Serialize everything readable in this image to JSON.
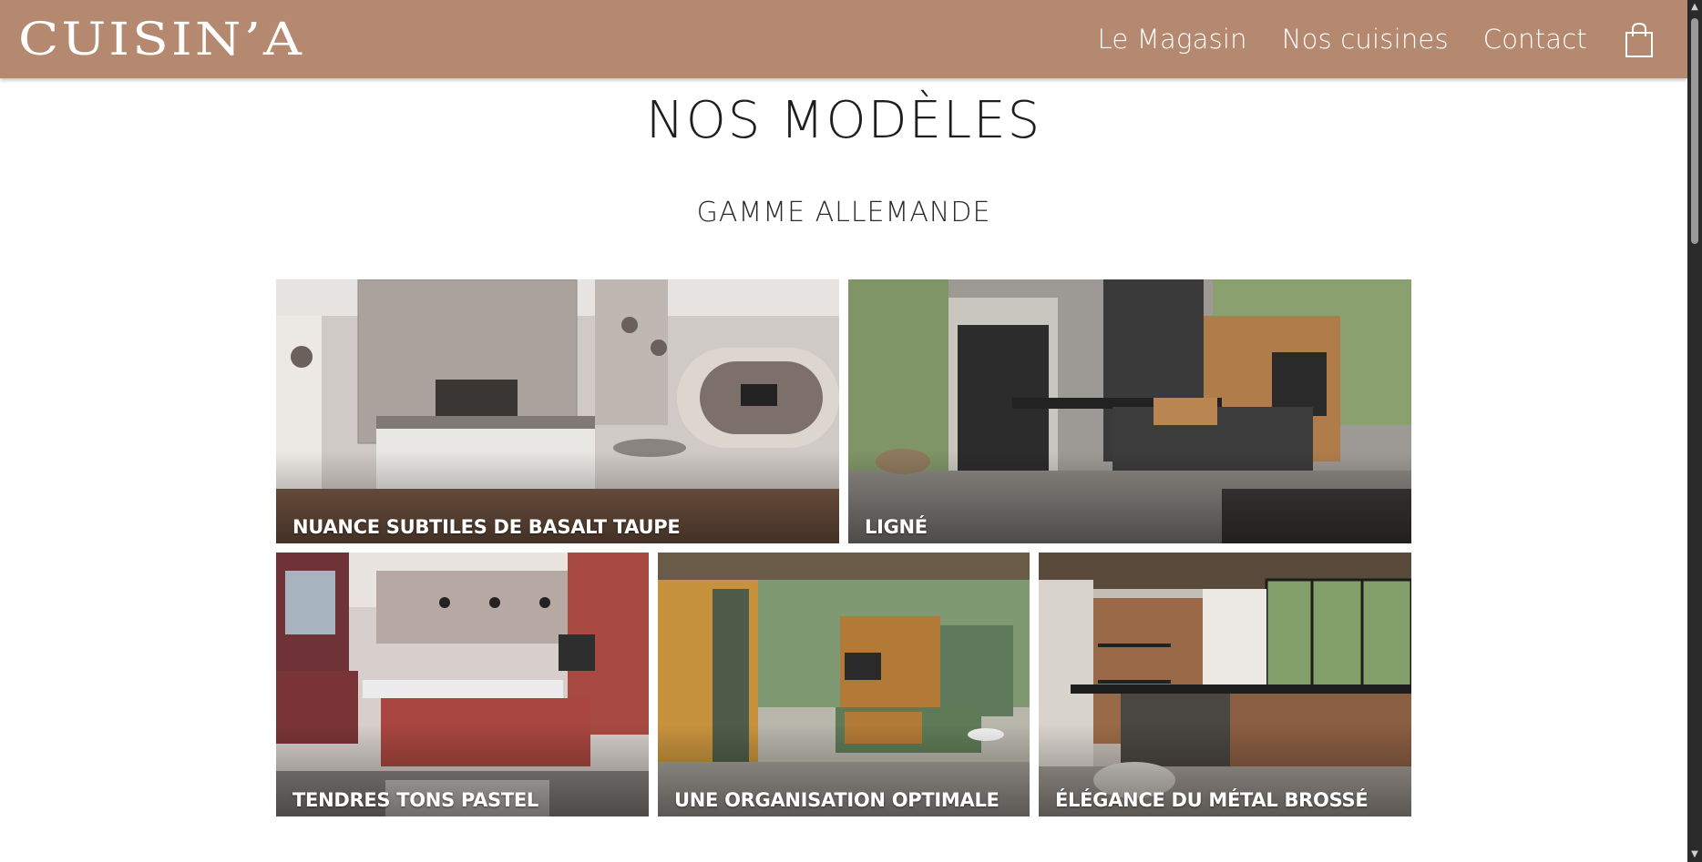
{
  "header": {
    "logo": "CUISIN’A",
    "nav": [
      "Le Magasin",
      "Nos cuisines",
      "Contact"
    ],
    "cart_icon": "shopping-bag-icon"
  },
  "main": {
    "title": "NOS MODÈLES",
    "subtitle": "GAMME ALLEMANDE",
    "models": [
      {
        "label": "NUANCE SUBTILES DE BASALT TAUPE"
      },
      {
        "label": "LIGNÉ"
      },
      {
        "label": "TENDRES TONS PASTEL"
      },
      {
        "label": "UNE ORGANISATION OPTIMALE"
      },
      {
        "label": "ÉLÉGANCE DU MÉTAL BROSSÉ"
      }
    ]
  },
  "colors": {
    "header_bg": "#b48970",
    "header_text": "#ffffff",
    "title_text": "#1e1e1e"
  }
}
